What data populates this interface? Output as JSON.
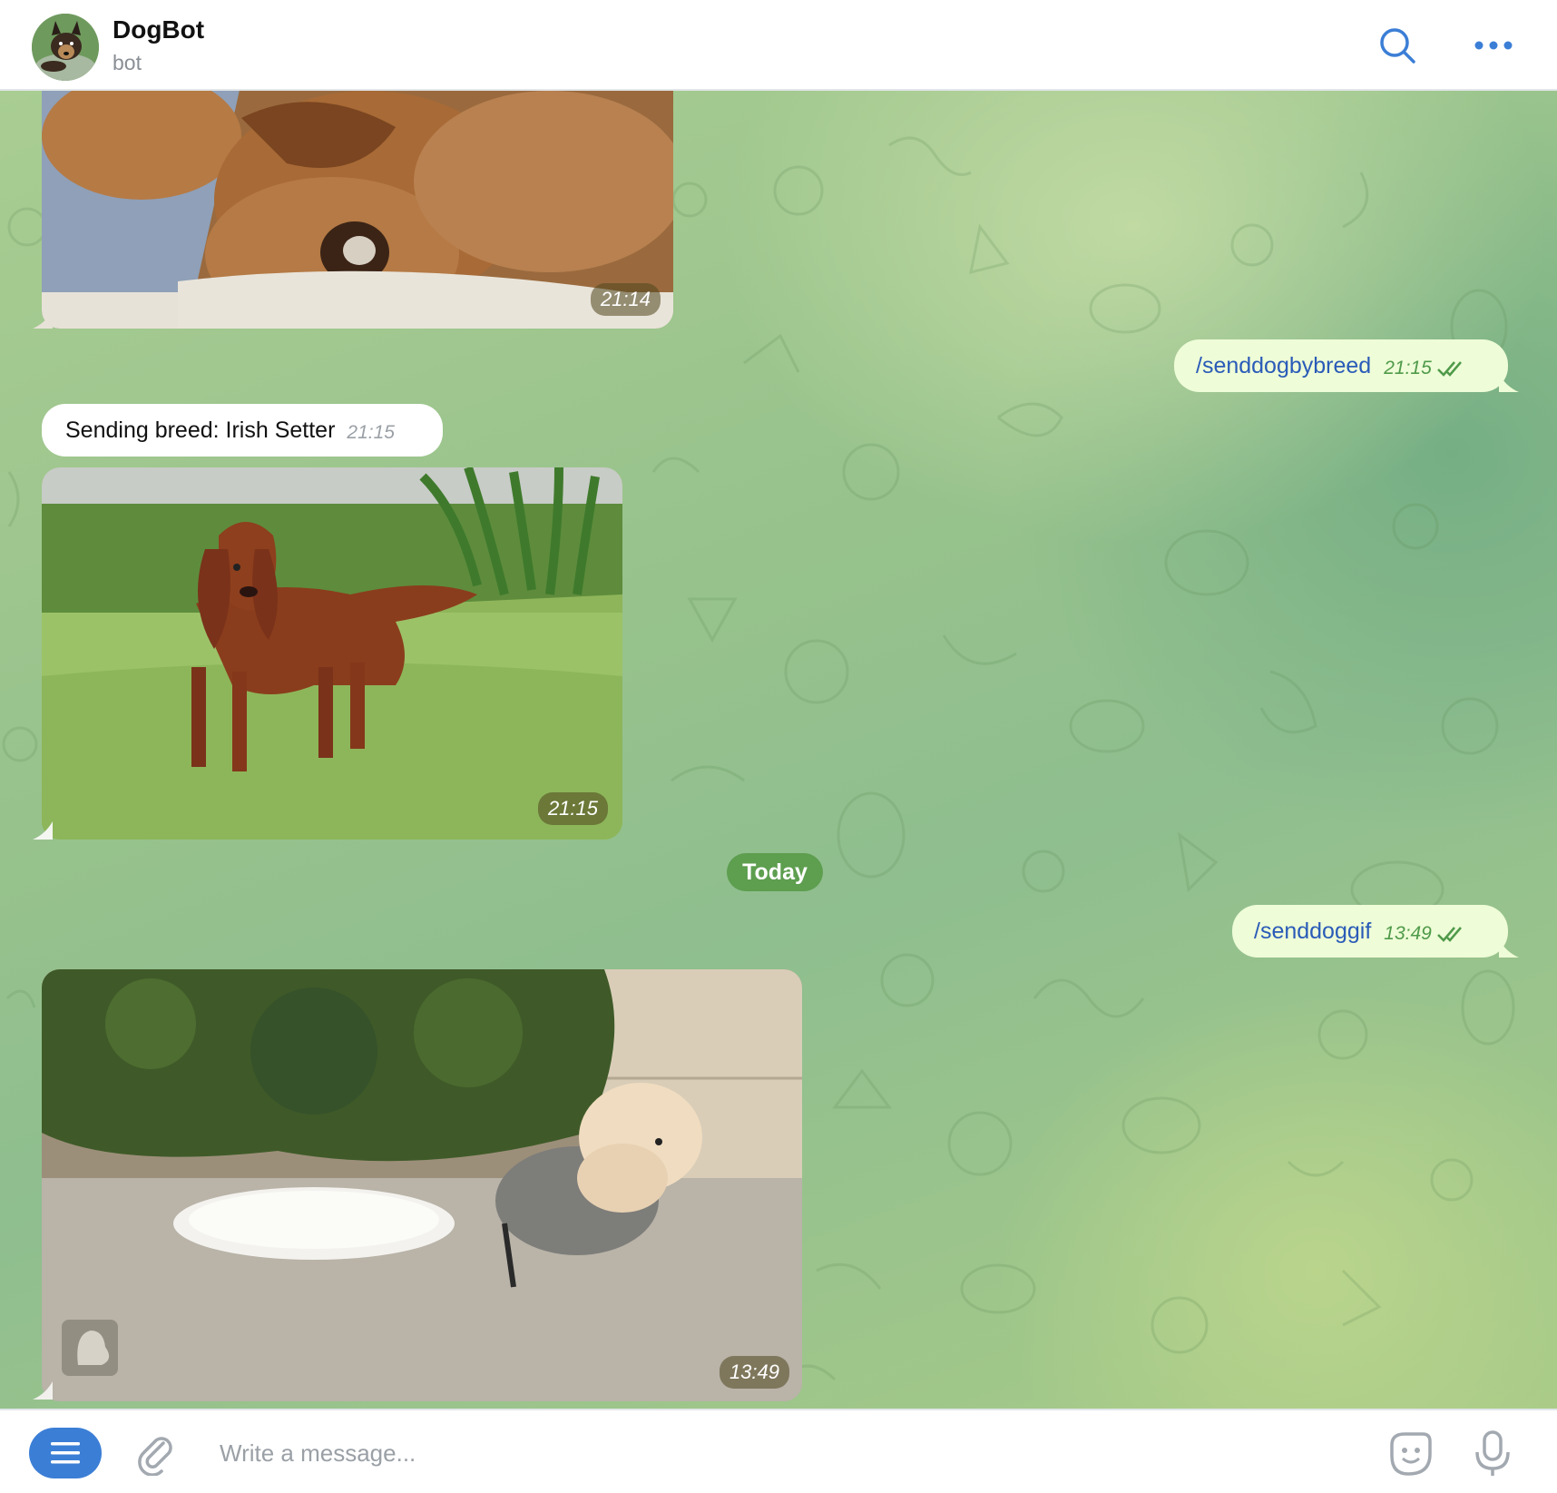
{
  "chat": {
    "title": "DogBot",
    "status": "bot"
  },
  "header": {
    "search_icon": "search-icon",
    "more_icon": "more-icon"
  },
  "messages": [
    {
      "type": "photo",
      "from": "bot",
      "time": "21:14"
    },
    {
      "type": "text",
      "from": "me",
      "text": "/senddogbybreed",
      "time": "21:15",
      "read": true
    },
    {
      "type": "text",
      "from": "bot",
      "text": "Sending breed: Irish Setter",
      "time": "21:15"
    },
    {
      "type": "photo",
      "from": "bot",
      "time": "21:15"
    },
    {
      "type": "date",
      "text": "Today"
    },
    {
      "type": "text",
      "from": "me",
      "text": "/senddoggif",
      "time": "13:49",
      "read": true
    },
    {
      "type": "gif",
      "from": "bot",
      "time": "13:49"
    }
  ],
  "composer": {
    "placeholder": "Write a message...",
    "menu_icon": "menu-icon",
    "attach_icon": "paperclip-icon",
    "emoji_icon": "sticker-icon",
    "mic_icon": "microphone-icon"
  },
  "colors": {
    "accent": "#3b7ed6",
    "outgoing_bubble": "#eefcd7",
    "date_pill": "#5d9e4f"
  }
}
